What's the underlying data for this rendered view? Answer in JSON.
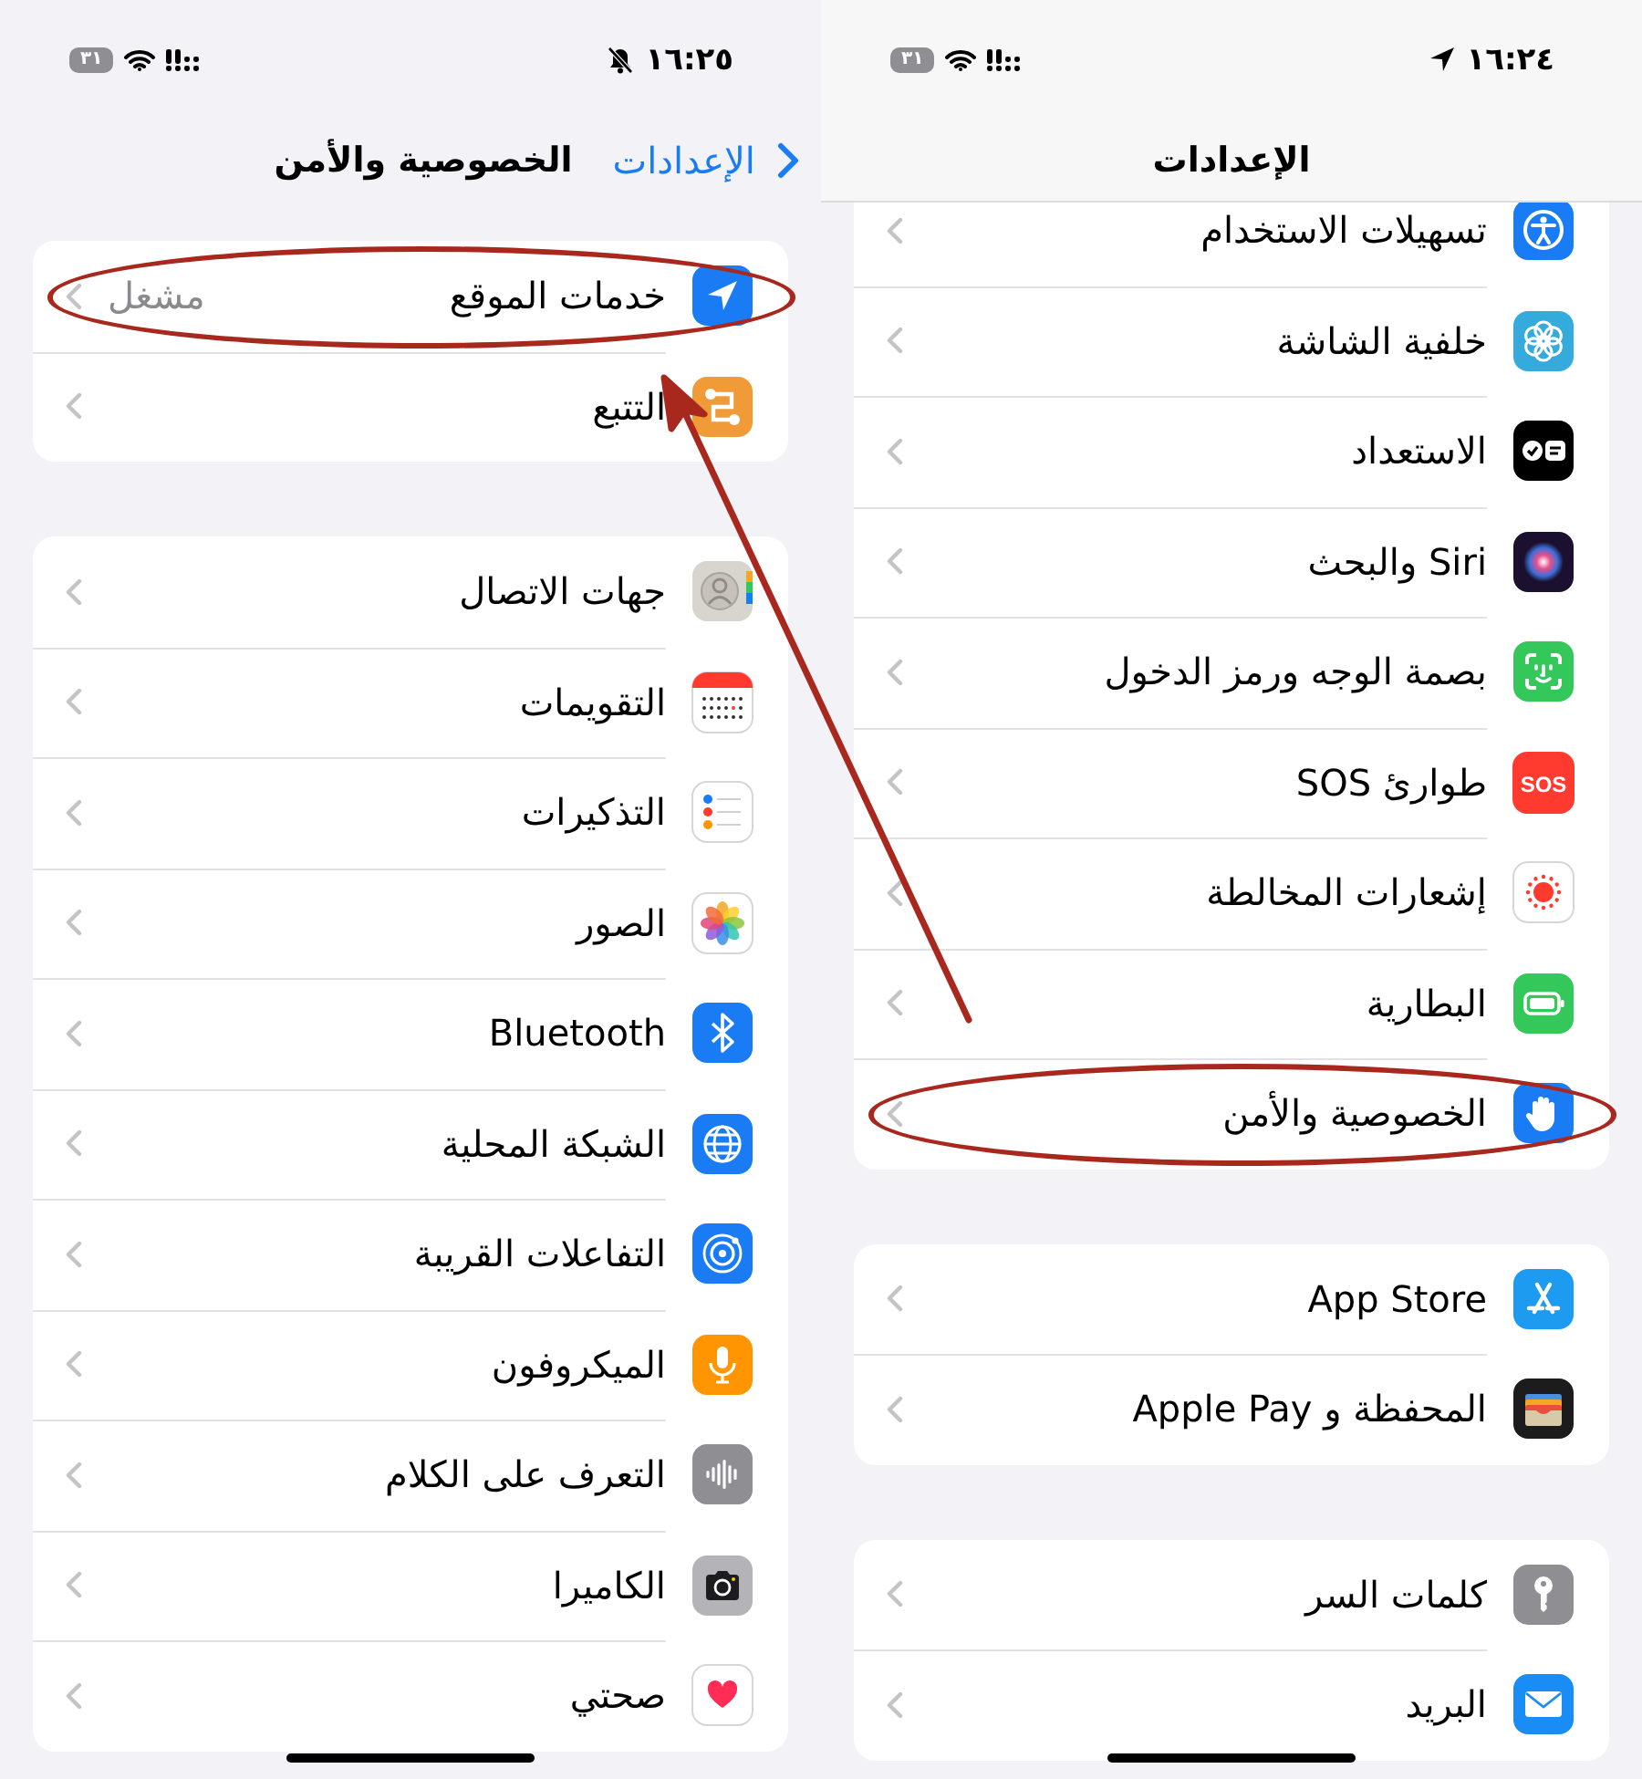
{
  "screens": [
    {
      "status_bar": {
        "time": "١٦:٢٤",
        "location": true,
        "muted": false,
        "battery": "٣١"
      },
      "scrolled": true,
      "nav": {
        "title": "الإعدادات"
      },
      "groups": [
        {
          "rows": [
            {
              "label": "تسهيلات الاستخدام",
              "circled": false
            },
            {
              "label": "خلفية الشاشة",
              "circled": false
            },
            {
              "label": "الاستعداد",
              "circled": false
            },
            {
              "label": "Siri والبحث",
              "circled": false
            },
            {
              "label": "بصمة الوجه ورمز الدخول",
              "circled": false
            },
            {
              "label": "طوارئ SOS",
              "icon_text": "SOS",
              "circled": false
            },
            {
              "label": "إشعارات المخالطة",
              "circled": false
            },
            {
              "label": "البطارية",
              "circled": false
            },
            {
              "label": "الخصوصية والأمن",
              "circled": true
            }
          ]
        },
        {
          "rows": [
            {
              "label": "App Store",
              "circled": false
            },
            {
              "label": "المحفظة و Apple Pay",
              "circled": false
            }
          ]
        },
        {
          "rows": [
            {
              "label": "كلمات السر",
              "circled": false
            },
            {
              "label": "البريد",
              "circled": false
            }
          ]
        }
      ]
    },
    {
      "status_bar": {
        "time": "١٦:٢٥",
        "location": false,
        "muted": true,
        "battery": "٣١"
      },
      "scrolled": false,
      "nav": {
        "back": "الإعدادات",
        "title": "الخصوصية والأمن"
      },
      "groups": [
        {
          "rows": [
            {
              "label": "خدمات الموقع",
              "value": "مشغل",
              "circled": true
            },
            {
              "label": "التتبع",
              "circled": false
            }
          ]
        },
        {
          "rows": [
            {
              "label": "جهات الاتصال",
              "circled": false
            },
            {
              "label": "التقويمات",
              "circled": false
            },
            {
              "label": "التذكيرات",
              "circled": false
            },
            {
              "label": "الصور",
              "circled": false
            },
            {
              "label": "Bluetooth",
              "circled": false
            },
            {
              "label": "الشبكة المحلية",
              "circled": false
            },
            {
              "label": "التفاعلات القريبة",
              "circled": false
            },
            {
              "label": "الميكروفون",
              "circled": false
            },
            {
              "label": "التعرف على الكلام",
              "circled": false
            },
            {
              "label": "الكاميرا",
              "circled": false
            },
            {
              "label": "صحتي",
              "circled": false
            }
          ]
        }
      ]
    }
  ],
  "arrow": true
}
